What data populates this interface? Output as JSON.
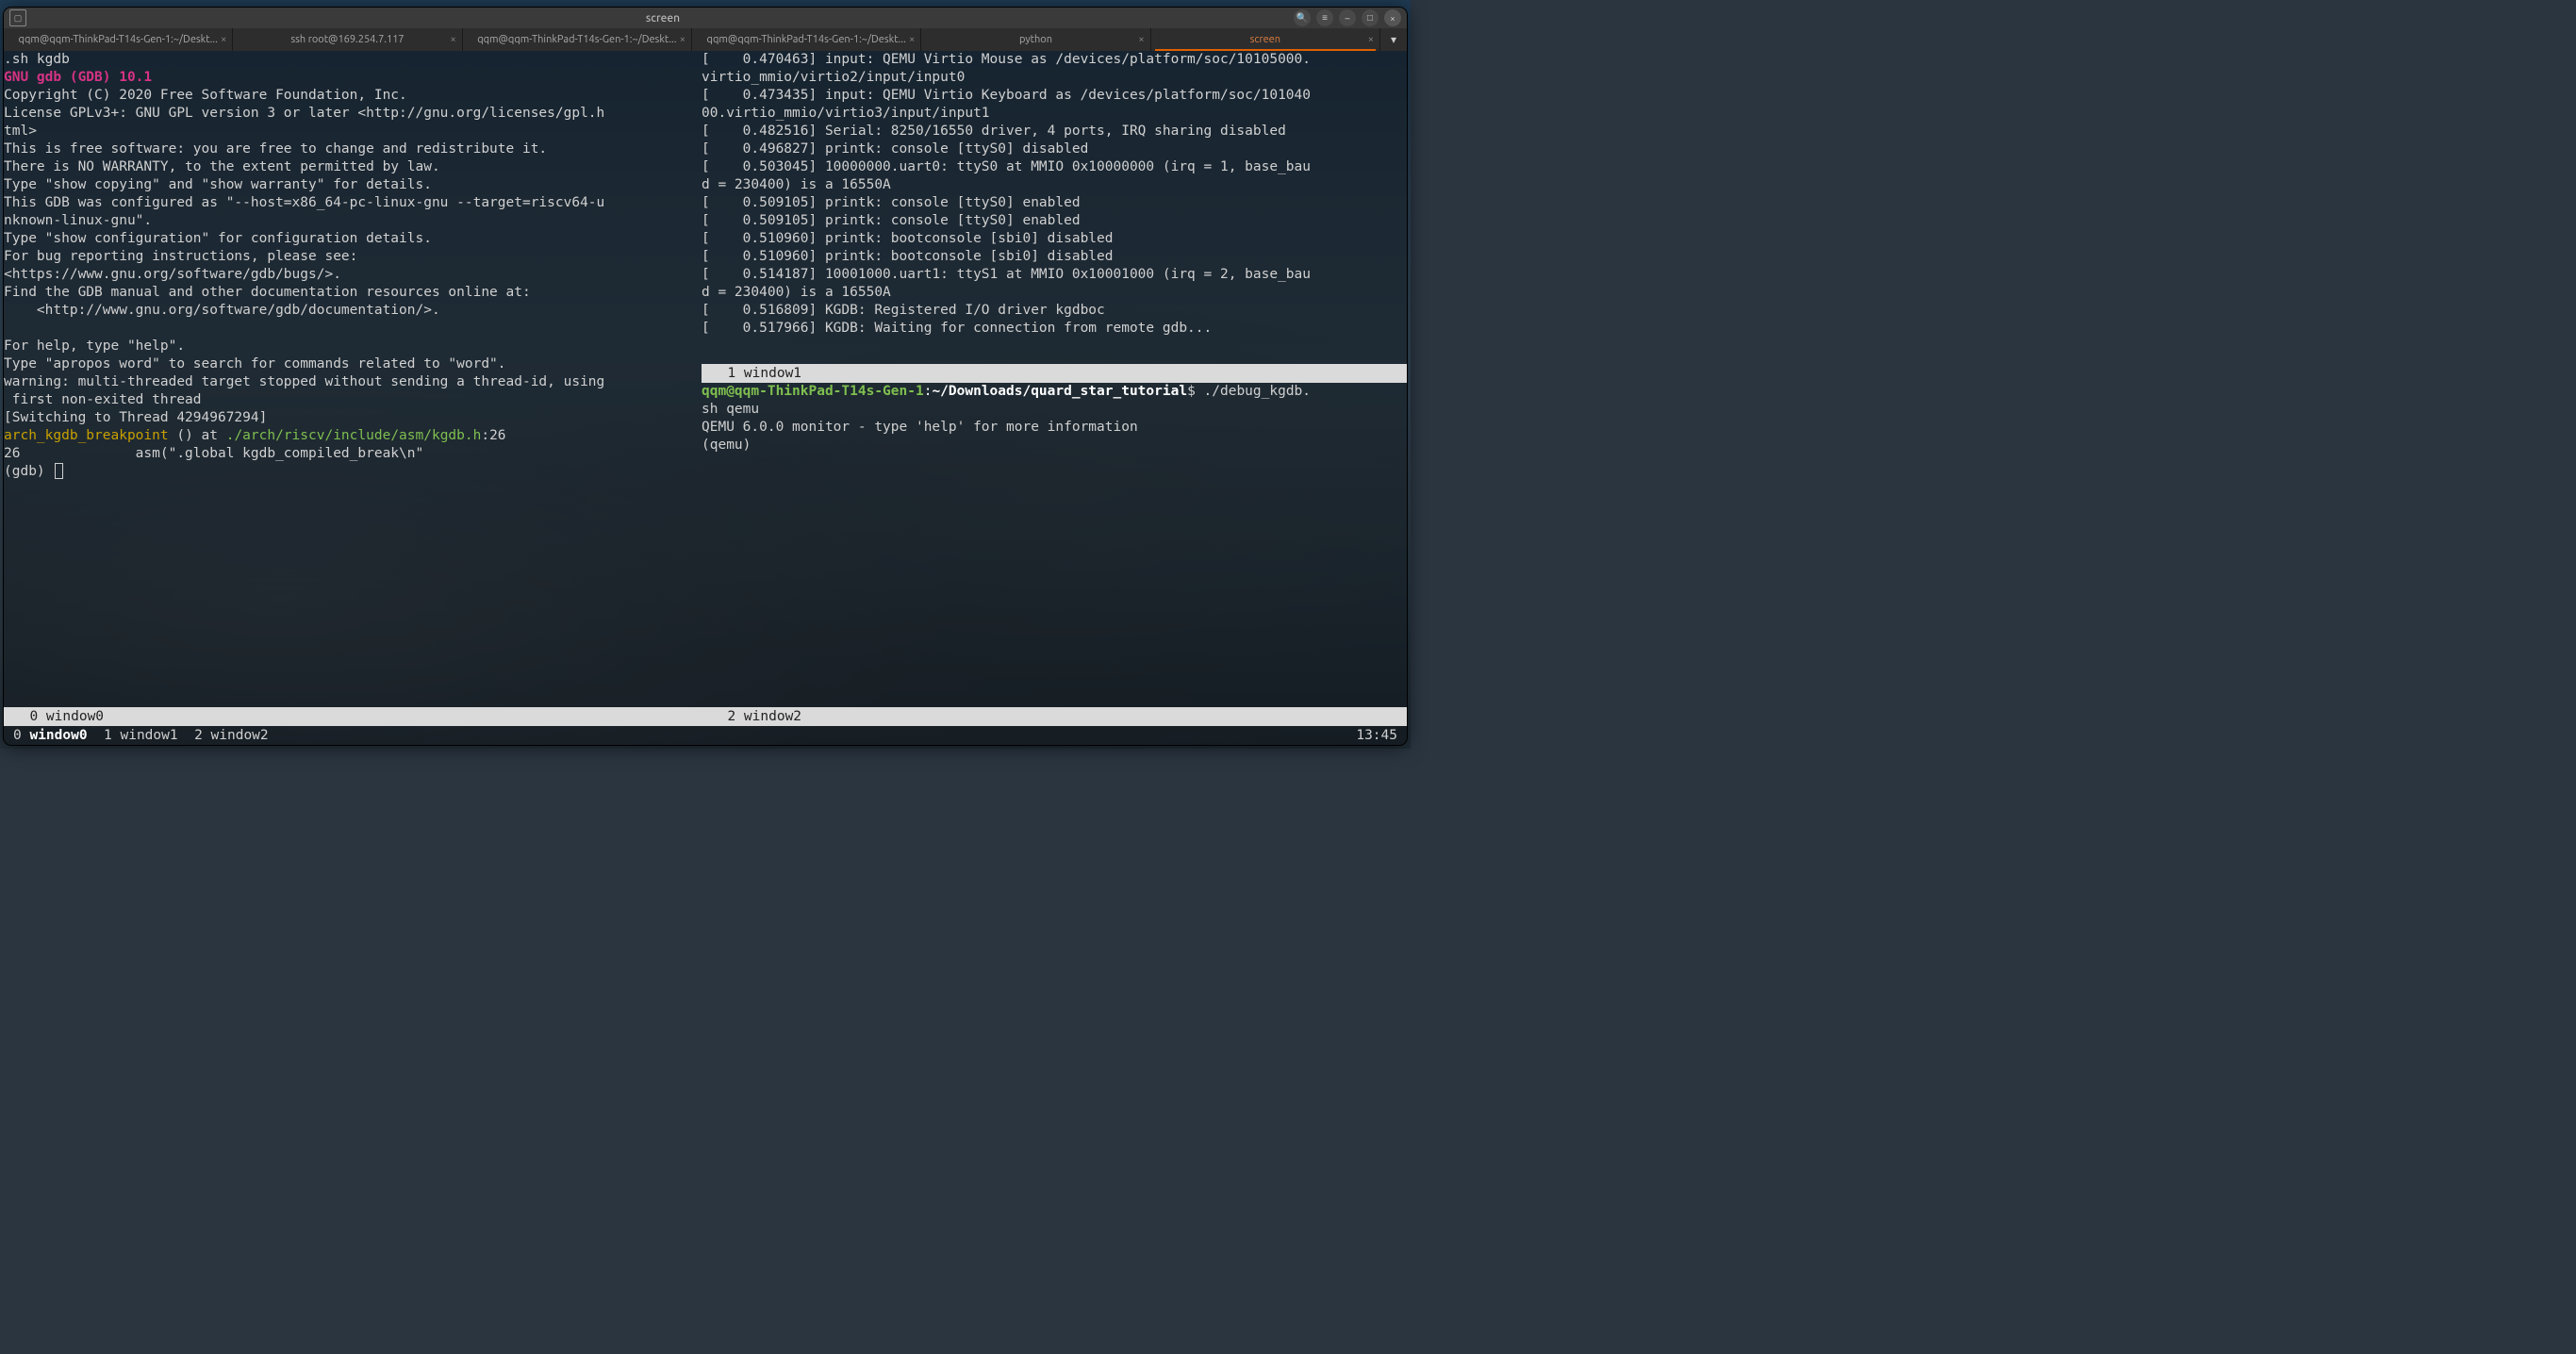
{
  "titlebar": {
    "title": "screen"
  },
  "tabs": [
    {
      "label": "qqm@qqm-ThinkPad-T14s-Gen-1:~/Deskt..."
    },
    {
      "label": "ssh root@169.254.7.117"
    },
    {
      "label": "qqm@qqm-ThinkPad-T14s-Gen-1:~/Deskt..."
    },
    {
      "label": "qqm@qqm-ThinkPad-T14s-Gen-1:~/Deskt..."
    },
    {
      "label": "python"
    },
    {
      "label": "screen"
    }
  ],
  "active_tab_index": 5,
  "pane_left": {
    "l0": ".sh kgdb",
    "l1": "GNU gdb (GDB) 10.1",
    "l2": "Copyright (C) 2020 Free Software Foundation, Inc.",
    "l3": "License GPLv3+: GNU GPL version 3 or later <http://gnu.org/licenses/gpl.h",
    "l4": "tml>",
    "l5": "This is free software: you are free to change and redistribute it.",
    "l6": "There is NO WARRANTY, to the extent permitted by law.",
    "l7": "Type \"show copying\" and \"show warranty\" for details.",
    "l8": "This GDB was configured as \"--host=x86_64-pc-linux-gnu --target=riscv64-u",
    "l9": "nknown-linux-gnu\".",
    "l10": "Type \"show configuration\" for configuration details.",
    "l11": "For bug reporting instructions, please see:",
    "l12": "<https://www.gnu.org/software/gdb/bugs/>.",
    "l13": "Find the GDB manual and other documentation resources online at:",
    "l14": "    <http://www.gnu.org/software/gdb/documentation/>.",
    "l15": "",
    "l16": "For help, type \"help\".",
    "l17": "Type \"apropos word\" to search for commands related to \"word\".",
    "l18": "warning: multi-threaded target stopped without sending a thread-id, using",
    "l19": " first non-exited thread",
    "l20": "[Switching to Thread 4294967294]",
    "l21a": "arch_kgdb_breakpoint",
    "l21b": " () at ",
    "l21c": "./arch/riscv/include/asm/kgdb.h",
    "l21d": ":26",
    "l22": "26              asm(\".global kgdb_compiled_break\\n\"",
    "l23": "(gdb) "
  },
  "pane_rtop": {
    "r0": "[    0.470463] input: QEMU Virtio Mouse as /devices/platform/soc/10105000.",
    "r1": "virtio_mmio/virtio2/input/input0",
    "r2": "[    0.473435] input: QEMU Virtio Keyboard as /devices/platform/soc/101040",
    "r3": "00.virtio_mmio/virtio3/input/input1",
    "r4": "[    0.482516] Serial: 8250/16550 driver, 4 ports, IRQ sharing disabled",
    "r5": "[    0.496827] printk: console [ttyS0] disabled",
    "r6": "[    0.503045] 10000000.uart0: ttyS0 at MMIO 0x10000000 (irq = 1, base_bau",
    "r7": "d = 230400) is a 16550A",
    "r8": "[    0.509105] printk: console [ttyS0] enabled",
    "r9": "[    0.509105] printk: console [ttyS0] enabled",
    "r10": "[    0.510960] printk: bootconsole [sbi0] disabled",
    "r11": "[    0.510960] printk: bootconsole [sbi0] disabled",
    "r12": "[    0.514187] 10001000.uart1: ttyS1 at MMIO 0x10001000 (irq = 2, base_bau",
    "r13": "d = 230400) is a 16550A",
    "r14": "[    0.516809] KGDB: Registered I/O driver kgdboc",
    "r15": "[    0.517966] KGDB: Waiting for connection from remote gdb..."
  },
  "pane_rbot": {
    "b0a": "qqm@qqm-ThinkPad-T14s-Gen-1",
    "b0b": ":",
    "b0c": "~/Downloads/quard_star_tutorial",
    "b0d": "$ ./debug_kgdb.",
    "b1": "sh qemu",
    "b2": "QEMU 6.0.0 monitor - type 'help' for more information",
    "b3": "(qemu) "
  },
  "status": {
    "left": "  0 window0",
    "rtop": "  1 window1",
    "rbot": "  2 window2",
    "global_left": "0 window0  1 window1  2 window2",
    "global_active": "window0",
    "clock": "13:45"
  }
}
